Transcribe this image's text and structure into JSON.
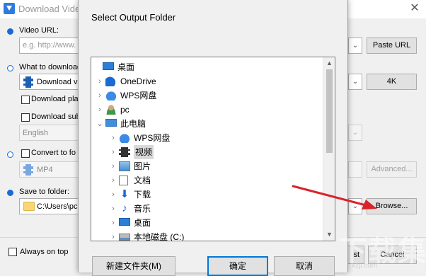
{
  "app": {
    "title": "Download Video",
    "close_glyph": "✕",
    "video_url_label": "Video URL:",
    "url_placeholder": "e.g. http://www.",
    "paste_url": "Paste URL",
    "what_to_download_label": "What to download",
    "download_option": "Download vi",
    "quality_button": "4K",
    "download_playlist_label": "Download play",
    "download_subtitles_label": "Download sub",
    "subtitle_language": "English",
    "convert_label": "Convert to fo",
    "format_value": "MP4",
    "advanced_button": "Advanced...",
    "save_folder_label": "Save to folder:",
    "save_folder_path": "C:\\Users\\pc",
    "browse_button": "Browse...",
    "always_on_top_label": "Always on top",
    "start_button_partial": "st",
    "cancel_button": "Cancel"
  },
  "dialog": {
    "title": "Select Output Folder",
    "tree": [
      {
        "label": "桌面",
        "icon": "desktop-icon",
        "level": 0,
        "expander": ""
      },
      {
        "label": "OneDrive",
        "icon": "onedrive-icon",
        "level": 1,
        "expander": "›"
      },
      {
        "label": "WPS网盘",
        "icon": "wps-cloud-icon",
        "level": 1,
        "expander": "›"
      },
      {
        "label": "pc",
        "icon": "user-icon",
        "level": 1,
        "expander": "›"
      },
      {
        "label": "此电脑",
        "icon": "computer-icon",
        "level": 1,
        "expander": "⌄"
      },
      {
        "label": "WPS网盘",
        "icon": "wps-cloud-icon",
        "level": 2,
        "expander": "›"
      },
      {
        "label": "视频",
        "icon": "video-folder-icon",
        "level": 2,
        "expander": "›",
        "selected": true
      },
      {
        "label": "图片",
        "icon": "pictures-folder-icon",
        "level": 2,
        "expander": "›"
      },
      {
        "label": "文档",
        "icon": "documents-folder-icon",
        "level": 2,
        "expander": "›"
      },
      {
        "label": "下载",
        "icon": "downloads-folder-icon",
        "level": 2,
        "expander": "›"
      },
      {
        "label": "音乐",
        "icon": "music-folder-icon",
        "level": 2,
        "expander": "›"
      },
      {
        "label": "桌面",
        "icon": "desktop-icon",
        "level": 2,
        "expander": "›"
      },
      {
        "label": "本地磁盘 (C:)",
        "icon": "disk-icon",
        "level": 2,
        "expander": "›"
      }
    ],
    "new_folder_button": "新建文件夹(M)",
    "ok_button": "确定",
    "cancel_button": "取消"
  },
  "watermark": {
    "text": "下载集",
    "url": "xzji.com"
  },
  "colors": {
    "accent": "#1a6ad6",
    "arrow": "#d9232a",
    "default_button_border": "#0078d7"
  }
}
